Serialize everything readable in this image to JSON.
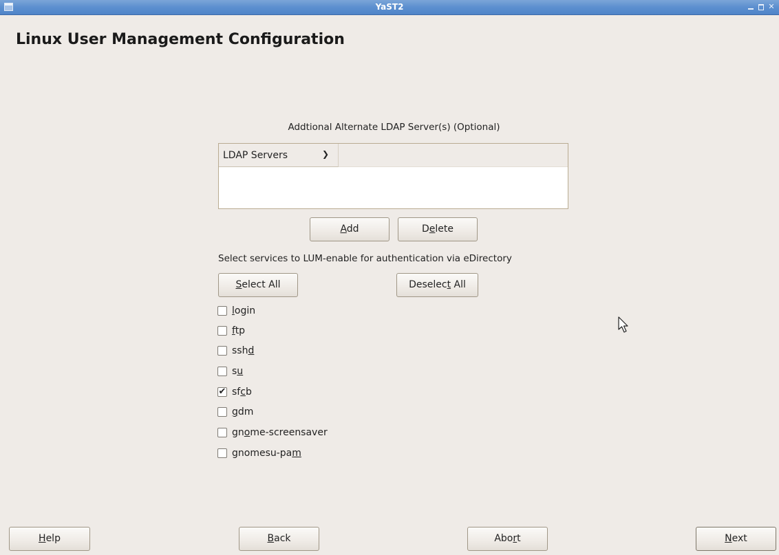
{
  "window": {
    "title": "YaST2"
  },
  "page": {
    "title": "Linux User Management Configuration"
  },
  "ldap": {
    "caption": "Addtional Alternate LDAP Server(s) (Optional)",
    "column_header": "LDAP Servers",
    "rows": []
  },
  "buttons": {
    "add": {
      "pre": "",
      "u": "A",
      "post": "dd"
    },
    "delete": {
      "pre": "D",
      "u": "e",
      "post": "lete"
    },
    "select_all": {
      "pre": "",
      "u": "S",
      "post": "elect All"
    },
    "deselect_all": {
      "pre": "Deselec",
      "u": "t",
      "post": " All"
    },
    "help": {
      "pre": "",
      "u": "H",
      "post": "elp"
    },
    "back": {
      "pre": "",
      "u": "B",
      "post": "ack"
    },
    "abort": {
      "pre": "Abo",
      "u": "r",
      "post": "t"
    },
    "next": {
      "pre": "",
      "u": "N",
      "post": "ext"
    }
  },
  "services": {
    "caption": "Select services to LUM-enable for authentication via eDirectory",
    "items": [
      {
        "pre": "",
        "u": "l",
        "post": "ogin",
        "checked": false
      },
      {
        "pre": "",
        "u": "f",
        "post": "tp",
        "checked": false
      },
      {
        "pre": "ssh",
        "u": "d",
        "post": "",
        "checked": false
      },
      {
        "pre": "s",
        "u": "u",
        "post": "",
        "checked": false
      },
      {
        "pre": "sf",
        "u": "c",
        "post": "b",
        "checked": true
      },
      {
        "pre": "",
        "u": "g",
        "post": "dm",
        "checked": false
      },
      {
        "pre": "gn",
        "u": "o",
        "post": "me-screensaver",
        "checked": false
      },
      {
        "pre": "gnomesu-pa",
        "u": "m",
        "post": "",
        "checked": false
      }
    ]
  },
  "check_mark": "✔"
}
